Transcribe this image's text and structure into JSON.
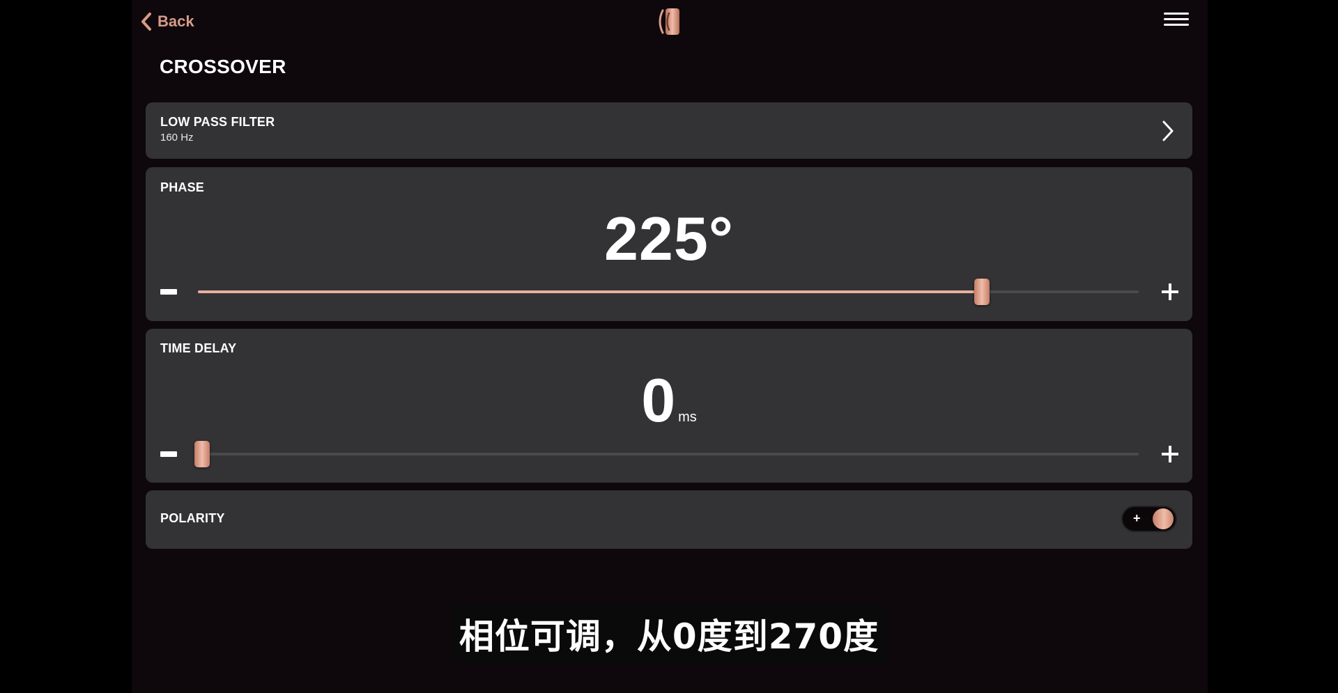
{
  "header": {
    "back_label": "Back",
    "logo_icon": "speaker-brand-logo",
    "menu_icon": "hamburger-menu-icon"
  },
  "page_title": "CROSSOVER",
  "low_pass_filter": {
    "title": "LOW PASS FILTER",
    "value": "160 Hz"
  },
  "phase": {
    "title": "PHASE",
    "value": "225°",
    "slider_fraction": 0.833
  },
  "time_delay": {
    "title": "TIME DELAY",
    "value": "0",
    "unit": "ms",
    "slider_fraction": 0.0
  },
  "polarity": {
    "title": "POLARITY",
    "sign": "+",
    "state": "positive"
  },
  "caption": "相位可调，从0度到270度",
  "colors": {
    "accent": "#e7b19d",
    "card_bg": "#333235",
    "app_bg": "#0e070c"
  }
}
